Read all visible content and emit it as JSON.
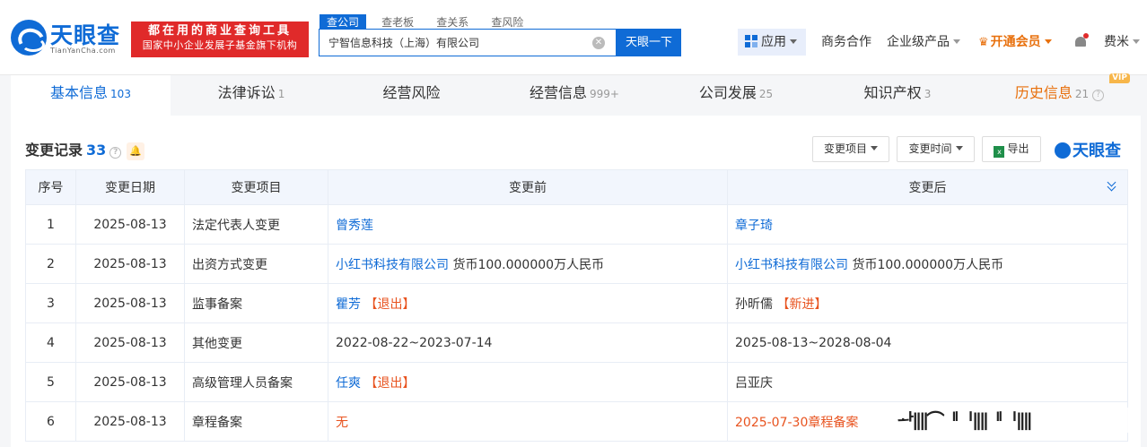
{
  "brand": {
    "name": "天眼查",
    "domain": "TianYanCha.com"
  },
  "slogan": {
    "line1": "都在用的商业查询工具",
    "line2": "国家中小企业发展子基金旗下机构"
  },
  "search": {
    "tabs": [
      "查公司",
      "查老板",
      "查关系",
      "查风险"
    ],
    "active_tab": "查公司",
    "value": "宁智信息科技（上海）有限公司",
    "button": "天眼一下"
  },
  "nav": {
    "apps": "应用",
    "business": "商务合作",
    "enterprise": "企业级产品",
    "vip": "开通会员",
    "user": "费米"
  },
  "tabs": [
    {
      "label": "基本信息",
      "count": "103"
    },
    {
      "label": "法律诉讼",
      "count": "1"
    },
    {
      "label": "经营风险",
      "count": ""
    },
    {
      "label": "经营信息",
      "count": "999+"
    },
    {
      "label": "公司发展",
      "count": "25"
    },
    {
      "label": "知识产权",
      "count": "3"
    },
    {
      "label": "历史信息",
      "count": "21",
      "tag": "VIP"
    }
  ],
  "section": {
    "title": "变更记录",
    "count": "33",
    "filter_item": "变更项目",
    "filter_time": "变更时间",
    "export": "导出",
    "brand": "天眼查"
  },
  "table": {
    "headers": [
      "序号",
      "变更日期",
      "变更项目",
      "变更前",
      "变更后"
    ],
    "rows": [
      {
        "no": "1",
        "date": "2025-08-13",
        "item": "法定代表人变更",
        "before": "曾秀莲",
        "after": "章子琦"
      },
      {
        "no": "2",
        "date": "2025-08-13",
        "item": "出资方式变更",
        "before_link": "小红书科技有限公司",
        "before_text": " 货币100.000000万人民币",
        "after_link": "小红书科技有限公司",
        "after_text": " 货币100.000000万人民币"
      },
      {
        "no": "3",
        "date": "2025-08-13",
        "item": "监事备案",
        "before": "瞿芳",
        "before_tag": "【退出】",
        "after": "孙昕儒",
        "after_tag": "【新进】"
      },
      {
        "no": "4",
        "date": "2025-08-13",
        "item": "其他变更",
        "before": "2022-08-22~2023-07-14",
        "after": "2025-08-13~2028-08-04"
      },
      {
        "no": "5",
        "date": "2025-08-13",
        "item": "高级管理人员备案",
        "before": "任爽",
        "before_tag": "【退出】",
        "after": "吕亚庆"
      },
      {
        "no": "6",
        "date": "2025-08-13",
        "item": "章程备案",
        "before": "无",
        "after": "2025-07-30章程备案"
      }
    ]
  },
  "colors": {
    "brand_blue": "#0f6bd6",
    "accent_orange": "#e8700d",
    "red": "#e02a2a"
  }
}
